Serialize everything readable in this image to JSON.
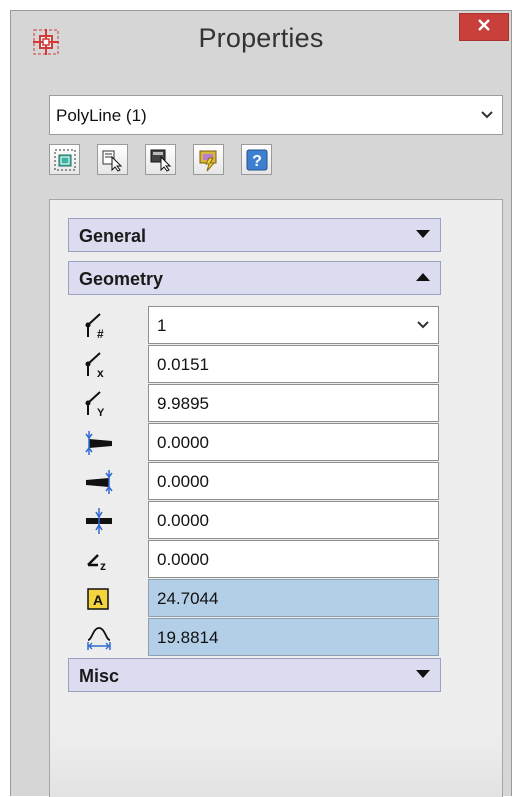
{
  "window": {
    "title": "Properties"
  },
  "object_selector": {
    "value": "PolyLine (1)"
  },
  "toolbar": {
    "buttons": [
      {
        "icon": "quick-select-icon"
      },
      {
        "icon": "select-objects-icon"
      },
      {
        "icon": "pick-add-icon"
      },
      {
        "icon": "toggle-pickadd-icon"
      },
      {
        "icon": "help-icon",
        "text": "?"
      }
    ]
  },
  "sections": {
    "general": {
      "label": "General",
      "state": "collapsed"
    },
    "geometry": {
      "label": "Geometry",
      "state": "expanded"
    },
    "misc": {
      "label": "Misc",
      "state": "collapsed"
    }
  },
  "geometry_rows": [
    {
      "icon": "current-vertex-icon",
      "subscript": "#",
      "value": "1",
      "dropdown": true
    },
    {
      "icon": "vertex-x-icon",
      "subscript": "x",
      "value": "0.0151"
    },
    {
      "icon": "vertex-y-icon",
      "subscript": "Y",
      "value": "9.9895"
    },
    {
      "icon": "start-segment-width-icon",
      "value": "0.0000"
    },
    {
      "icon": "end-segment-width-icon",
      "value": "0.0000"
    },
    {
      "icon": "global-width-icon",
      "value": "0.0000"
    },
    {
      "icon": "elevation-icon",
      "subscript": "z",
      "value": "0.0000"
    },
    {
      "icon": "area-icon",
      "text": "A",
      "value": "24.7044",
      "highlighted": true
    },
    {
      "icon": "length-icon",
      "value": "19.8814",
      "highlighted": true
    }
  ],
  "colors": {
    "close_button": "#c9403b",
    "section_header": "#dcdcf0",
    "highlight_field": "#b3cfe8",
    "app_icon": "#d23a3a"
  }
}
